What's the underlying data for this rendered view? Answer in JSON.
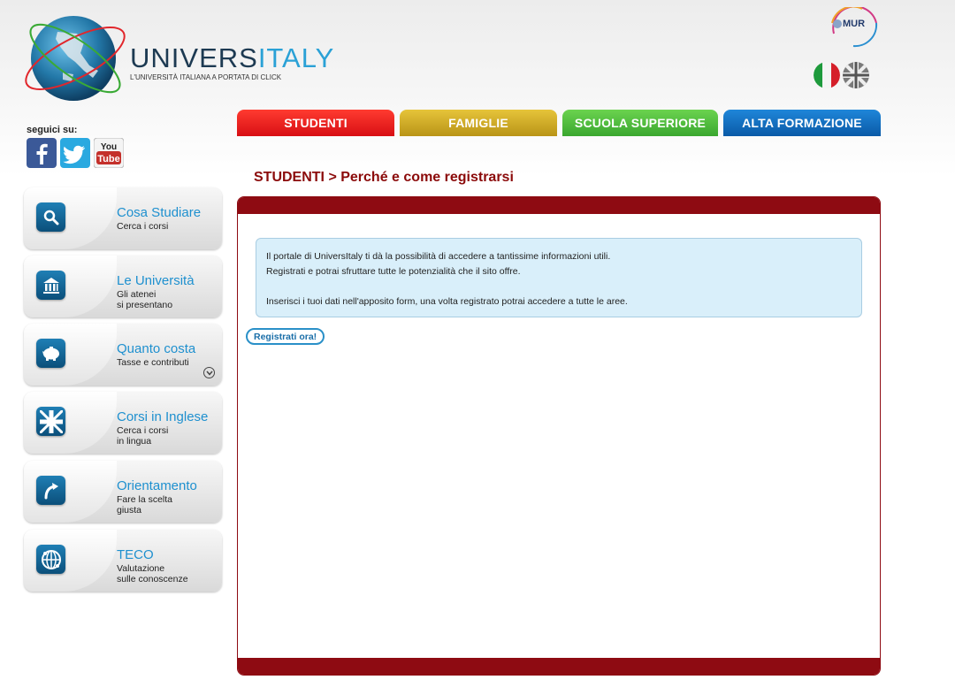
{
  "header": {
    "logo_title_a": "UNIVERS",
    "logo_title_b": "ITALY",
    "logo_subtitle": "L'UNIVERSITÀ ITALIANA A PORTATA DI CLICK",
    "ministry_label": "MUR",
    "languages": [
      {
        "name": "italian-flag-icon"
      },
      {
        "name": "uk-flag-icon"
      }
    ]
  },
  "social": {
    "label": "seguici su:",
    "youtube_top": "You",
    "youtube_bottom": "Tube"
  },
  "tabs": [
    {
      "label": "STUDENTI",
      "color": "#e5121b"
    },
    {
      "label": "FAMIGLIE",
      "color": "#c9a82a"
    },
    {
      "label": "SCUOLA SUPERIORE",
      "color": "#4cb93c"
    },
    {
      "label": "ALTA FORMAZIONE",
      "color": "#0f6cc0"
    }
  ],
  "sidebar": {
    "items": [
      {
        "title": "Cosa Studiare",
        "subtitle": "Cerca i corsi",
        "icon": "search-icon"
      },
      {
        "title": "Le Università",
        "subtitle": "Gli atenei\nsi presentano",
        "icon": "university-building-icon"
      },
      {
        "title": "Quanto costa",
        "subtitle": "Tasse e contributi",
        "icon": "piggy-bank-icon"
      },
      {
        "title": "Corsi in Inglese",
        "subtitle": "Cerca i corsi\nin lingua",
        "icon": "union-jack-icon"
      },
      {
        "title": "Orientamento",
        "subtitle": "Fare la scelta\ngiusta",
        "icon": "arrow-turn-icon"
      },
      {
        "title": "TECO",
        "subtitle": "Valutazione\nsulle conoscenze",
        "icon": "teco-globe-icon"
      }
    ]
  },
  "main": {
    "breadcrumb": "STUDENTI > Perché e come registrarsi",
    "info_line1": "Il portale di UniversItaly ti dà la possibilità di accedere a tantissime informazioni utili.",
    "info_line2": "Registrati e potrai sfruttare tutte le potenzialità che il sito offre.",
    "info_line3": "Inserisci i tuoi dati nell'apposito form, una volta registrato potrai accedere a tutte le aree.",
    "register_button": "Registrati ora!"
  },
  "colors": {
    "panel_border": "#8e0b12",
    "breadcrumb": "#8b0a0a",
    "sidebar_title": "#1e90cf",
    "info_bg": "#d9effa"
  }
}
